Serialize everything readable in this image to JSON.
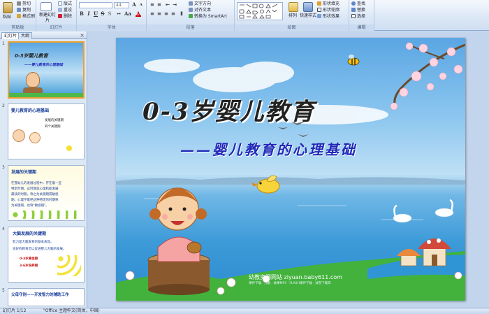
{
  "ribbon": {
    "clipboard": {
      "label": "剪贴板",
      "paste": "粘贴",
      "cut": "剪切",
      "copy": "复制",
      "format_painter": "格式刷"
    },
    "slides": {
      "label": "幻灯片",
      "new_slide": "新建幻灯片",
      "layout": "版式",
      "reset": "重设",
      "delete": "删除"
    },
    "font": {
      "label": "字体",
      "font_size": "44"
    },
    "paragraph": {
      "label": "段落",
      "text_direction": "文字方向",
      "align_text": "对齐文本",
      "smartart": "转换为 SmartArt"
    },
    "drawing": {
      "label": "绘图",
      "arrange": "排列",
      "quick_styles": "快速样式",
      "shape_fill": "形状填充",
      "shape_outline": "形状轮廓",
      "shape_effects": "形状效果"
    },
    "editing": {
      "label": "编辑",
      "find": "查找",
      "replace": "替换",
      "select": "选择"
    }
  },
  "pane": {
    "tab_slides": "幻灯片",
    "tab_outline": "大纲",
    "close": "×"
  },
  "thumbnails": [
    {
      "num": "1",
      "title": "0-3岁婴儿教育",
      "sub": "——婴儿教育的心理基础"
    },
    {
      "num": "2",
      "title": "婴儿教育的心理基础",
      "lines": [
        "发展的关键期",
        "四个关键期"
      ]
    },
    {
      "num": "3",
      "title": "发展的关键期",
      "lines": [
        "在婴幼儿的发展过程中，存在着一些",
        "特定时期，这时期是心理机能发展",
        "最快的时期，称之为关键期或敏感",
        "期。心理学家把这种特定的时期称",
        "为关键期，也称\"敏感期\"。"
      ]
    },
    {
      "num": "4",
      "title": "大脑发展的关键期",
      "lines": [
        "智力是大脑发育的基本表现。",
        "良好的教育可以促进婴儿大脑的发展。",
        "0-3岁黄金期",
        "3-6岁培养期"
      ]
    },
    {
      "num": "5",
      "title": "父母守则——开发智力的辅助工作"
    }
  ],
  "slide": {
    "title": "0-3岁婴儿教育",
    "subtitle": "——婴儿教育的心理基础",
    "watermark": "幼教资源网站  ziyuan.baby611.com",
    "watermark_sub": "课件下载 · 儿歌 · 故事MP3 · FLASH课件下载 · 试卷下载等"
  },
  "status": {
    "slide_info": "幻灯片 1/12",
    "theme": "\"Office 主题\"",
    "language": "中文(简体，中国)"
  }
}
